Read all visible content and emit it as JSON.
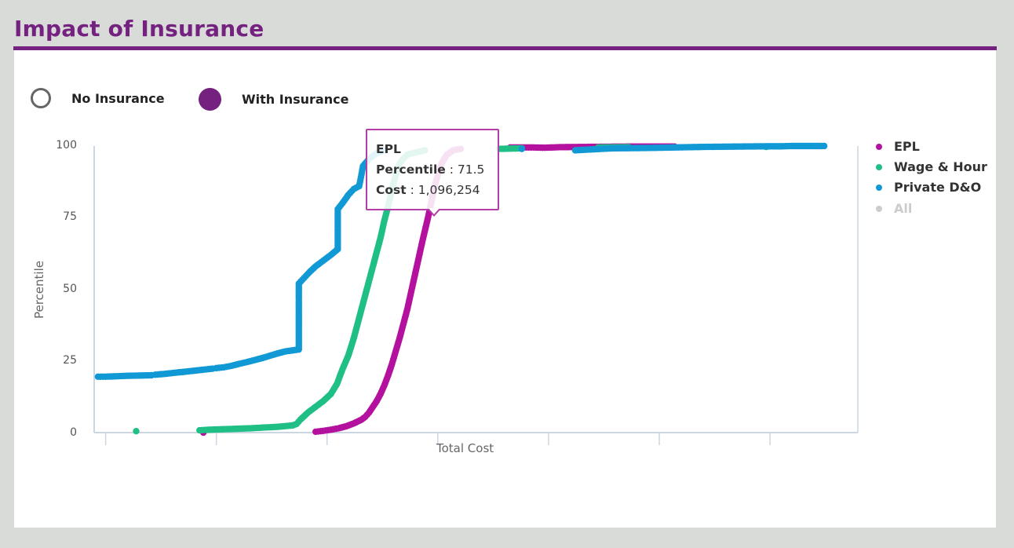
{
  "page": {
    "title": "Impact of Insurance",
    "accent_color": "#742180"
  },
  "toggles": {
    "no_insurance": {
      "label": "No Insurance",
      "selected": false
    },
    "with_insurance": {
      "label": "With Insurance",
      "selected": true
    }
  },
  "tooltip": {
    "series": "EPL",
    "percentile_label": "Percentile",
    "percentile_value": "71.5",
    "cost_label": "Cost",
    "cost_value": "1,096,254"
  },
  "chart_data": {
    "type": "scatter",
    "title": "Impact of Insurance",
    "xlabel": "Total Cost",
    "ylabel": "Percentile",
    "xlim": [
      0,
      1000
    ],
    "x_units_note": "x-axis has no tick labels; x expressed in relative cost units along axis",
    "ylim": [
      0,
      100
    ],
    "yticks": [
      "0",
      "25",
      "50",
      "75",
      "100"
    ],
    "ytick_values": [
      0,
      25,
      50,
      75,
      100
    ],
    "xtick_values": [
      15,
      160,
      305,
      450,
      595,
      740,
      885
    ],
    "legend_position": "right",
    "grid": false,
    "series": [
      {
        "name": "EPL",
        "color": "#b4119e",
        "visible": true,
        "points": [
          [
            143,
            0
          ],
          [
            290,
            0.3
          ],
          [
            300,
            0.6
          ],
          [
            310,
            1
          ],
          [
            320,
            1.5
          ],
          [
            330,
            2.2
          ],
          [
            340,
            3.2
          ],
          [
            350,
            4.5
          ],
          [
            355,
            5.5
          ],
          [
            360,
            7
          ],
          [
            365,
            9
          ],
          [
            370,
            11
          ],
          [
            375,
            13.5
          ],
          [
            380,
            16.5
          ],
          [
            385,
            20
          ],
          [
            390,
            24
          ],
          [
            395,
            28.5
          ],
          [
            400,
            33
          ],
          [
            405,
            38
          ],
          [
            410,
            43
          ],
          [
            415,
            49
          ],
          [
            420,
            55
          ],
          [
            425,
            61
          ],
          [
            430,
            67
          ],
          [
            434,
            71.5
          ],
          [
            438,
            76
          ],
          [
            442,
            81
          ],
          [
            446,
            86
          ],
          [
            450,
            90
          ],
          [
            455,
            94
          ],
          [
            462,
            97
          ],
          [
            470,
            98.5
          ],
          [
            480,
            99
          ],
          [
            545,
            99.5
          ],
          [
            560,
            99.5
          ],
          [
            575,
            99.5
          ],
          [
            590,
            99.4
          ],
          [
            610,
            99.6
          ],
          [
            650,
            99.7
          ],
          [
            700,
            99.8
          ],
          [
            760,
            99.8
          ]
        ]
      },
      {
        "name": "Wage & Hour",
        "color": "#1fbf85",
        "visible": true,
        "points": [
          [
            55,
            0.5
          ],
          [
            138,
            0.8
          ],
          [
            150,
            1
          ],
          [
            205,
            1.5
          ],
          [
            225,
            1.8
          ],
          [
            240,
            2
          ],
          [
            260,
            2.5
          ],
          [
            265,
            3
          ],
          [
            270,
            4.5
          ],
          [
            280,
            7
          ],
          [
            290,
            9
          ],
          [
            300,
            11
          ],
          [
            310,
            13.5
          ],
          [
            318,
            17
          ],
          [
            325,
            22
          ],
          [
            333,
            27
          ],
          [
            340,
            33
          ],
          [
            345,
            38
          ],
          [
            350,
            43
          ],
          [
            355,
            48
          ],
          [
            360,
            53
          ],
          [
            365,
            58
          ],
          [
            370,
            63
          ],
          [
            375,
            68
          ],
          [
            380,
            74
          ],
          [
            385,
            79
          ],
          [
            390,
            85
          ],
          [
            395,
            90
          ],
          [
            400,
            94
          ],
          [
            410,
            97
          ],
          [
            425,
            98
          ],
          [
            433,
            98.5
          ],
          [
            530,
            99
          ],
          [
            560,
            99.2
          ],
          [
            660,
            99.5
          ],
          [
            700,
            99.6
          ],
          [
            880,
            99.7
          ]
        ]
      },
      {
        "name": "Private D&O",
        "color": "#1199d5",
        "visible": true,
        "points": [
          [
            5,
            19.5
          ],
          [
            15,
            19.5
          ],
          [
            43,
            19.8
          ],
          [
            75,
            20
          ],
          [
            80,
            20.2
          ],
          [
            93,
            20.5
          ],
          [
            110,
            21
          ],
          [
            118,
            21.2
          ],
          [
            138,
            21.8
          ],
          [
            155,
            22.3
          ],
          [
            160,
            22.5
          ],
          [
            170,
            22.8
          ],
          [
            180,
            23.3
          ],
          [
            190,
            24
          ],
          [
            200,
            24.6
          ],
          [
            210,
            25.3
          ],
          [
            220,
            26
          ],
          [
            230,
            26.8
          ],
          [
            240,
            27.6
          ],
          [
            250,
            28.3
          ],
          [
            268,
            29
          ],
          [
            268,
            40
          ],
          [
            268,
            52
          ],
          [
            275,
            54
          ],
          [
            282,
            56
          ],
          [
            290,
            58
          ],
          [
            300,
            60
          ],
          [
            310,
            62
          ],
          [
            319,
            64
          ],
          [
            319,
            72
          ],
          [
            319,
            78
          ],
          [
            325,
            80
          ],
          [
            333,
            83
          ],
          [
            340,
            85
          ],
          [
            347,
            86
          ],
          [
            350,
            90
          ],
          [
            352,
            93
          ],
          [
            360,
            95.5
          ],
          [
            370,
            97.5
          ],
          [
            380,
            98.5
          ],
          [
            560,
            99
          ],
          [
            630,
            98.5
          ],
          [
            650,
            98.8
          ],
          [
            680,
            99.2
          ],
          [
            720,
            99.3
          ],
          [
            760,
            99.5
          ],
          [
            800,
            99.7
          ],
          [
            840,
            99.8
          ],
          [
            880,
            99.9
          ],
          [
            900,
            99.9
          ],
          [
            913,
            100
          ],
          [
            950,
            100
          ],
          [
            956,
            100
          ]
        ]
      },
      {
        "name": "All",
        "color": "#cccccc",
        "visible": false,
        "points": []
      }
    ]
  }
}
